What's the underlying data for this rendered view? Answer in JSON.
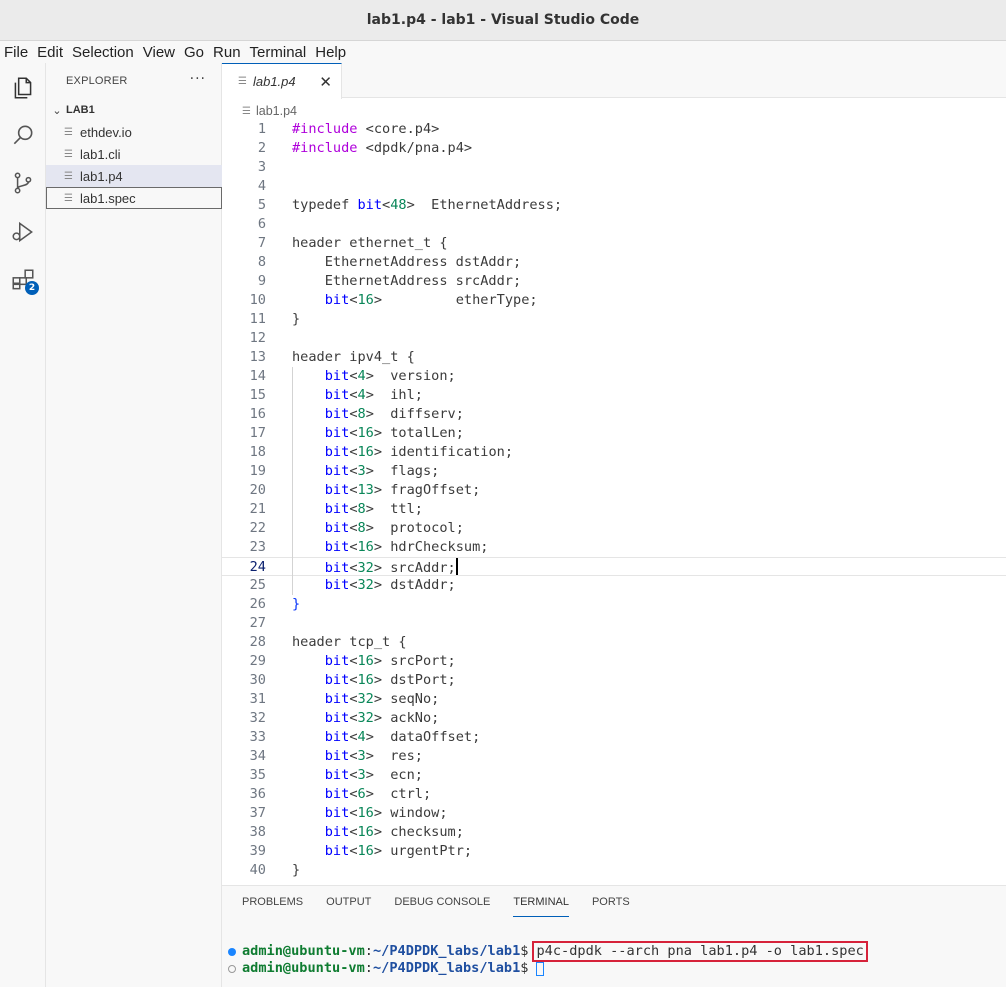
{
  "window": {
    "title": "lab1.p4 - lab1 - Visual Studio Code"
  },
  "menu": [
    "File",
    "Edit",
    "Selection",
    "View",
    "Go",
    "Run",
    "Terminal",
    "Help"
  ],
  "activity_bar": {
    "items": [
      "explorer-icon",
      "search-icon",
      "source-control-icon",
      "run-debug-icon",
      "extensions-icon"
    ],
    "extensions_badge": "2"
  },
  "explorer": {
    "header": "EXPLORER",
    "more": "···",
    "folder": "LAB1",
    "files": [
      "ethdev.io",
      "lab1.cli",
      "lab1.p4",
      "lab1.spec"
    ],
    "active_file": "lab1.p4",
    "focused_file": "lab1.spec"
  },
  "editor": {
    "tab": {
      "label": "lab1.p4",
      "close": "✕"
    },
    "breadcrumb": "lab1.p4",
    "current_line": 24,
    "lines": [
      {
        "n": "1",
        "t": "#include <core.p4>"
      },
      {
        "n": "2",
        "t": "#include <dpdk/pna.p4>"
      },
      {
        "n": "3",
        "t": ""
      },
      {
        "n": "4",
        "t": ""
      },
      {
        "n": "5",
        "t": "typedef bit<48>  EthernetAddress;"
      },
      {
        "n": "6",
        "t": ""
      },
      {
        "n": "7",
        "t": "header ethernet_t {"
      },
      {
        "n": "8",
        "t": "    EthernetAddress dstAddr;"
      },
      {
        "n": "9",
        "t": "    EthernetAddress srcAddr;"
      },
      {
        "n": "10",
        "t": "    bit<16>         etherType;"
      },
      {
        "n": "11",
        "t": "}"
      },
      {
        "n": "12",
        "t": ""
      },
      {
        "n": "13",
        "t": "header ipv4_t {"
      },
      {
        "n": "14",
        "t": "    bit<4>  version;"
      },
      {
        "n": "15",
        "t": "    bit<4>  ihl;"
      },
      {
        "n": "16",
        "t": "    bit<8>  diffserv;"
      },
      {
        "n": "17",
        "t": "    bit<16> totalLen;"
      },
      {
        "n": "18",
        "t": "    bit<16> identification;"
      },
      {
        "n": "19",
        "t": "    bit<3>  flags;"
      },
      {
        "n": "20",
        "t": "    bit<13> fragOffset;"
      },
      {
        "n": "21",
        "t": "    bit<8>  ttl;"
      },
      {
        "n": "22",
        "t": "    bit<8>  protocol;"
      },
      {
        "n": "23",
        "t": "    bit<16> hdrChecksum;"
      },
      {
        "n": "24",
        "t": "    bit<32> srcAddr;"
      },
      {
        "n": "25",
        "t": "    bit<32> dstAddr;"
      },
      {
        "n": "26",
        "t": "}"
      },
      {
        "n": "27",
        "t": ""
      },
      {
        "n": "28",
        "t": "header tcp_t {"
      },
      {
        "n": "29",
        "t": "    bit<16> srcPort;"
      },
      {
        "n": "30",
        "t": "    bit<16> dstPort;"
      },
      {
        "n": "31",
        "t": "    bit<32> seqNo;"
      },
      {
        "n": "32",
        "t": "    bit<32> ackNo;"
      },
      {
        "n": "33",
        "t": "    bit<4>  dataOffset;"
      },
      {
        "n": "34",
        "t": "    bit<3>  res;"
      },
      {
        "n": "35",
        "t": "    bit<3>  ecn;"
      },
      {
        "n": "36",
        "t": "    bit<6>  ctrl;"
      },
      {
        "n": "37",
        "t": "    bit<16> window;"
      },
      {
        "n": "38",
        "t": "    bit<16> checksum;"
      },
      {
        "n": "39",
        "t": "    bit<16> urgentPtr;"
      },
      {
        "n": "40",
        "t": "}"
      }
    ]
  },
  "panel": {
    "tabs": [
      "PROBLEMS",
      "OUTPUT",
      "DEBUG CONSOLE",
      "TERMINAL",
      "PORTS"
    ],
    "active_tab": "TERMINAL",
    "terminal": [
      {
        "user": "admin@ubuntu-vm",
        "sep": ":",
        "path": "~/P4DPDK_labs/lab1",
        "prompt": "$",
        "command": "p4c-dpdk --arch pna lab1.p4 -o lab1.spec"
      },
      {
        "user": "admin@ubuntu-vm",
        "sep": ":",
        "path": "~/P4DPDK_labs/lab1",
        "prompt": "$",
        "command": ""
      }
    ]
  },
  "colors": {
    "accent": "#005fb8",
    "keyword_directive": "#af00db",
    "keyword_type": "#0000ff",
    "number": "#098658",
    "command_highlight": "#d6223a",
    "terminal_user": "#0f7c31",
    "terminal_path": "#1f4fa0"
  }
}
